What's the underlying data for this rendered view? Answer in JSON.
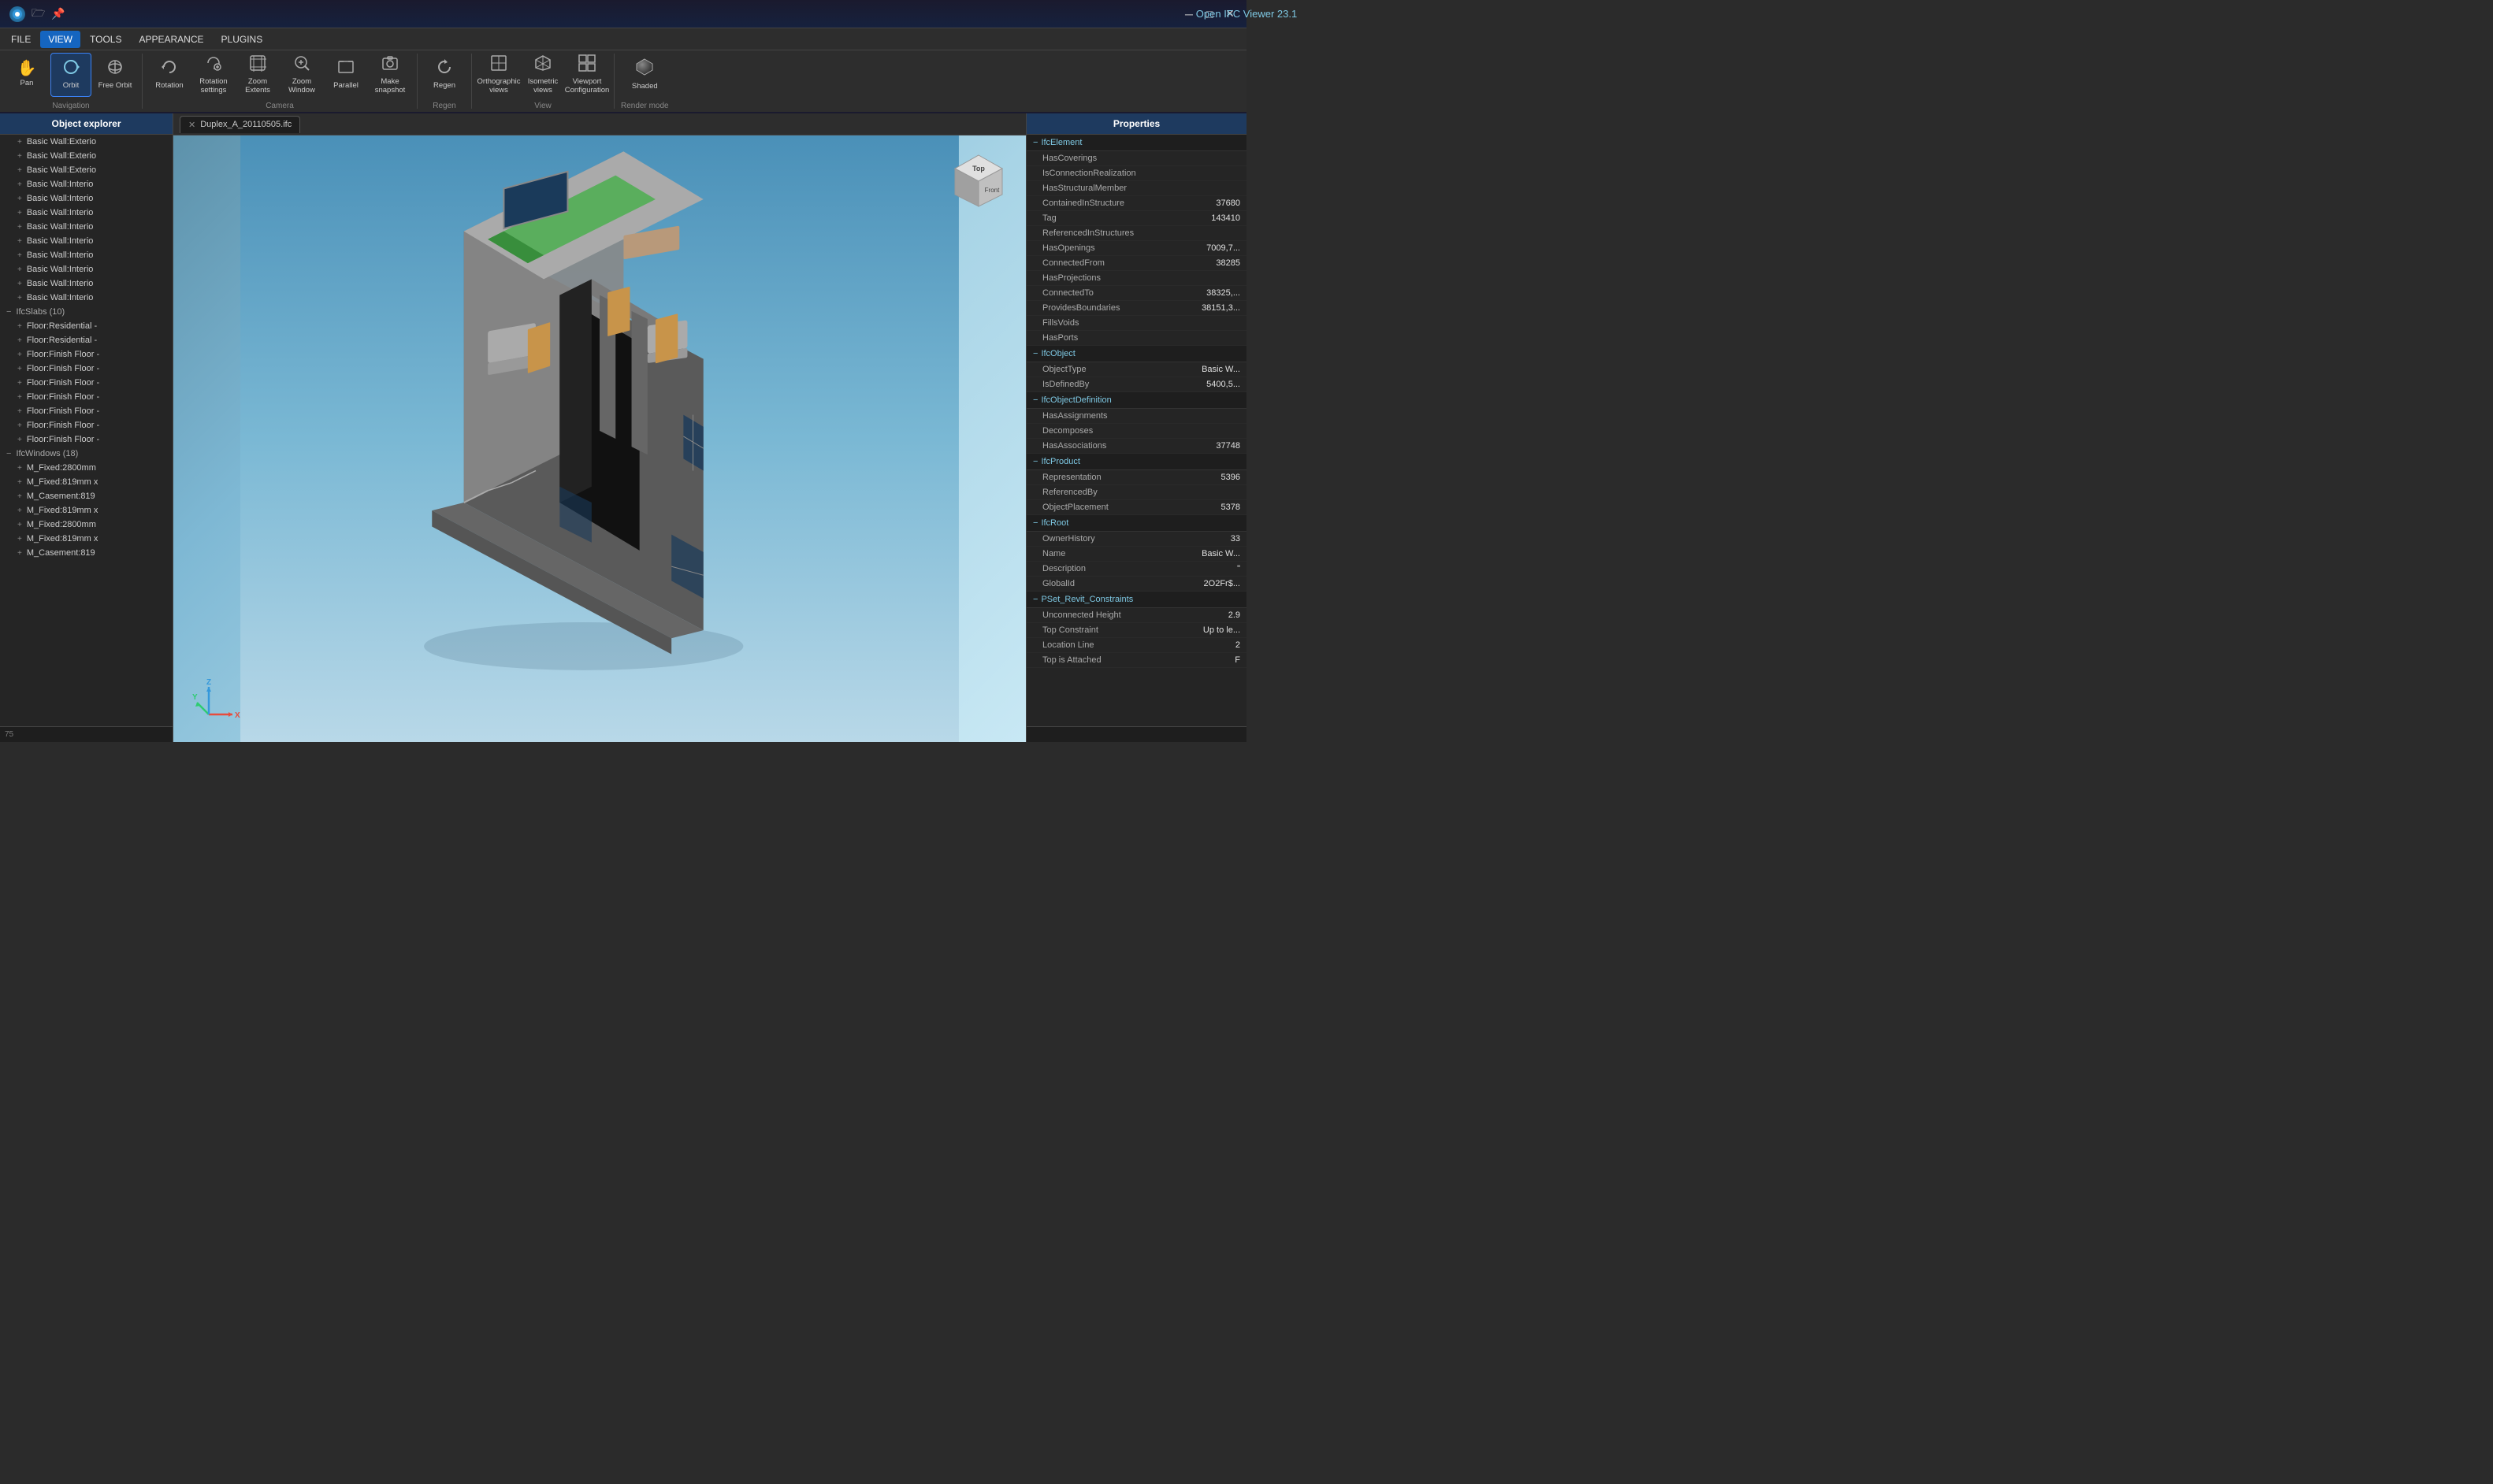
{
  "app": {
    "title": "Open IFC Viewer 23.1",
    "logo_icon": "circle-icon"
  },
  "window_controls": {
    "minimize_label": "─",
    "maximize_label": "□",
    "close_label": "✕"
  },
  "title_icons": [
    "circle-icon",
    "folder-icon",
    "pin-icon"
  ],
  "menu": {
    "items": [
      {
        "id": "file",
        "label": "FILE",
        "active": false
      },
      {
        "id": "view",
        "label": "VIEW",
        "active": true
      },
      {
        "id": "tools",
        "label": "TOOLS",
        "active": false
      },
      {
        "id": "appearance",
        "label": "APPEARANCE",
        "active": false
      },
      {
        "id": "plugins",
        "label": "PLUGINS",
        "active": false
      }
    ]
  },
  "toolbar": {
    "groups": [
      {
        "id": "navigation",
        "label": "Navigation",
        "buttons": [
          {
            "id": "pan",
            "label": "Pan",
            "icon": "✋",
            "active": false
          },
          {
            "id": "orbit",
            "label": "Orbit",
            "icon": "⟳",
            "active": true
          },
          {
            "id": "free-orbit",
            "label": "Free Orbit",
            "icon": "↻",
            "active": false
          }
        ]
      },
      {
        "id": "camera",
        "label": "Camera",
        "buttons": [
          {
            "id": "rotation",
            "label": "Rotation",
            "icon": "⟲",
            "active": false
          },
          {
            "id": "rotation-settings",
            "label": "Rotation settings",
            "icon": "⚙",
            "active": false
          },
          {
            "id": "zoom-extents",
            "label": "Zoom Extents",
            "icon": "⛶",
            "active": false
          },
          {
            "id": "zoom-window",
            "label": "Zoom Window",
            "icon": "🔍",
            "active": false
          },
          {
            "id": "parallel",
            "label": "Parallel",
            "icon": "▱",
            "active": false
          },
          {
            "id": "make-snapshot",
            "label": "Make snapshot",
            "icon": "📷",
            "active": false
          }
        ]
      },
      {
        "id": "regen-group",
        "label": "Regen",
        "buttons": [
          {
            "id": "regen",
            "label": "Regen",
            "icon": "↺",
            "active": false
          }
        ]
      },
      {
        "id": "view-group",
        "label": "View",
        "buttons": [
          {
            "id": "orthographic-views",
            "label": "Orthographic views",
            "icon": "⬜",
            "active": false
          },
          {
            "id": "isometric-views",
            "label": "Isometric views",
            "icon": "◈",
            "active": false
          },
          {
            "id": "viewport-config",
            "label": "Viewport Configuration",
            "icon": "⊞",
            "active": false
          }
        ]
      },
      {
        "id": "render-mode",
        "label": "Render mode",
        "buttons": [
          {
            "id": "shaded",
            "label": "Shaded",
            "icon": "◉",
            "active": false
          }
        ]
      }
    ]
  },
  "object_explorer": {
    "header": "Object explorer",
    "items": [
      {
        "type": "leaf",
        "label": "Basic Wall:Exterio",
        "indent": 1
      },
      {
        "type": "leaf",
        "label": "Basic Wall:Exterio",
        "indent": 1
      },
      {
        "type": "leaf",
        "label": "Basic Wall:Exterio",
        "indent": 1
      },
      {
        "type": "leaf",
        "label": "Basic Wall:Interio",
        "indent": 1
      },
      {
        "type": "leaf",
        "label": "Basic Wall:Interio",
        "indent": 1
      },
      {
        "type": "leaf",
        "label": "Basic Wall:Interio",
        "indent": 1
      },
      {
        "type": "leaf",
        "label": "Basic Wall:Interio",
        "indent": 1
      },
      {
        "type": "leaf",
        "label": "Basic Wall:Interio",
        "indent": 1
      },
      {
        "type": "leaf",
        "label": "Basic Wall:Interio",
        "indent": 1
      },
      {
        "type": "leaf",
        "label": "Basic Wall:Interio",
        "indent": 1
      },
      {
        "type": "leaf",
        "label": "Basic Wall:Interio",
        "indent": 1
      },
      {
        "type": "leaf",
        "label": "Basic Wall:Interio",
        "indent": 1
      },
      {
        "type": "group",
        "label": "IfcSlabs (10)",
        "indent": 0
      },
      {
        "type": "leaf",
        "label": "Floor:Residential -",
        "indent": 1
      },
      {
        "type": "leaf",
        "label": "Floor:Residential -",
        "indent": 1
      },
      {
        "type": "leaf",
        "label": "Floor:Finish Floor -",
        "indent": 1
      },
      {
        "type": "leaf",
        "label": "Floor:Finish Floor -",
        "indent": 1
      },
      {
        "type": "leaf",
        "label": "Floor:Finish Floor -",
        "indent": 1
      },
      {
        "type": "leaf",
        "label": "Floor:Finish Floor -",
        "indent": 1
      },
      {
        "type": "leaf",
        "label": "Floor:Finish Floor -",
        "indent": 1
      },
      {
        "type": "leaf",
        "label": "Floor:Finish Floor -",
        "indent": 1
      },
      {
        "type": "leaf",
        "label": "Floor:Finish Floor -",
        "indent": 1
      },
      {
        "type": "group",
        "label": "IfcWindows (18)",
        "indent": 0
      },
      {
        "type": "leaf",
        "label": "M_Fixed:2800mm",
        "indent": 1
      },
      {
        "type": "leaf",
        "label": "M_Fixed:819mm x",
        "indent": 1
      },
      {
        "type": "leaf",
        "label": "M_Casement:819",
        "indent": 1
      },
      {
        "type": "leaf",
        "label": "M_Fixed:819mm x",
        "indent": 1
      },
      {
        "type": "leaf",
        "label": "M_Fixed:2800mm",
        "indent": 1
      },
      {
        "type": "leaf",
        "label": "M_Fixed:819mm x",
        "indent": 1
      },
      {
        "type": "leaf",
        "label": "M_Casement:819",
        "indent": 1
      }
    ],
    "bottom_value": "75"
  },
  "viewport": {
    "tab_label": "Duplex_A_20110505.ifc",
    "tab_close": "×"
  },
  "properties": {
    "header": "Properties",
    "groups": [
      {
        "id": "ifc-element",
        "label": "IfcElement",
        "properties": [
          {
            "name": "HasCoverings",
            "value": ""
          },
          {
            "name": "IsConnectionRealization",
            "value": ""
          },
          {
            "name": "HasStructuralMember",
            "value": ""
          },
          {
            "name": "ContainedInStructure",
            "value": "37680"
          },
          {
            "name": "Tag",
            "value": "143410"
          },
          {
            "name": "ReferencedInStructures",
            "value": ""
          },
          {
            "name": "HasOpenings",
            "value": "7009,7..."
          },
          {
            "name": "ConnectedFrom",
            "value": "38285"
          },
          {
            "name": "HasProjections",
            "value": ""
          },
          {
            "name": "ConnectedTo",
            "value": "38325,..."
          },
          {
            "name": "ProvidesBoundaries",
            "value": "38151,3..."
          },
          {
            "name": "FillsVoids",
            "value": ""
          },
          {
            "name": "HasPorts",
            "value": ""
          }
        ]
      },
      {
        "id": "ifc-object",
        "label": "IfcObject",
        "properties": [
          {
            "name": "ObjectType",
            "value": "Basic W..."
          },
          {
            "name": "IsDefinedBy",
            "value": "5400,5..."
          }
        ]
      },
      {
        "id": "ifc-object-definition",
        "label": "IfcObjectDefinition",
        "properties": [
          {
            "name": "HasAssignments",
            "value": ""
          },
          {
            "name": "Decomposes",
            "value": ""
          },
          {
            "name": "HasAssociations",
            "value": "37748"
          }
        ]
      },
      {
        "id": "ifc-product",
        "label": "IfcProduct",
        "properties": [
          {
            "name": "Representation",
            "value": "5396"
          },
          {
            "name": "ReferencedBy",
            "value": ""
          },
          {
            "name": "ObjectPlacement",
            "value": "5378"
          }
        ]
      },
      {
        "id": "ifc-root",
        "label": "IfcRoot",
        "properties": [
          {
            "name": "OwnerHistory",
            "value": "33"
          },
          {
            "name": "Name",
            "value": "Basic W..."
          },
          {
            "name": "Description",
            "value": "\""
          },
          {
            "name": "GlobalId",
            "value": "2O2Fr$..."
          }
        ]
      },
      {
        "id": "pset-revit-constraints",
        "label": "PSet_Revit_Constraints",
        "properties": [
          {
            "name": "Unconnected Height",
            "value": "2.9"
          },
          {
            "name": "Top Constraint",
            "value": "Up to le..."
          },
          {
            "name": "Location Line",
            "value": "2"
          },
          {
            "name": "Top is Attached",
            "value": "F"
          }
        ]
      }
    ]
  }
}
